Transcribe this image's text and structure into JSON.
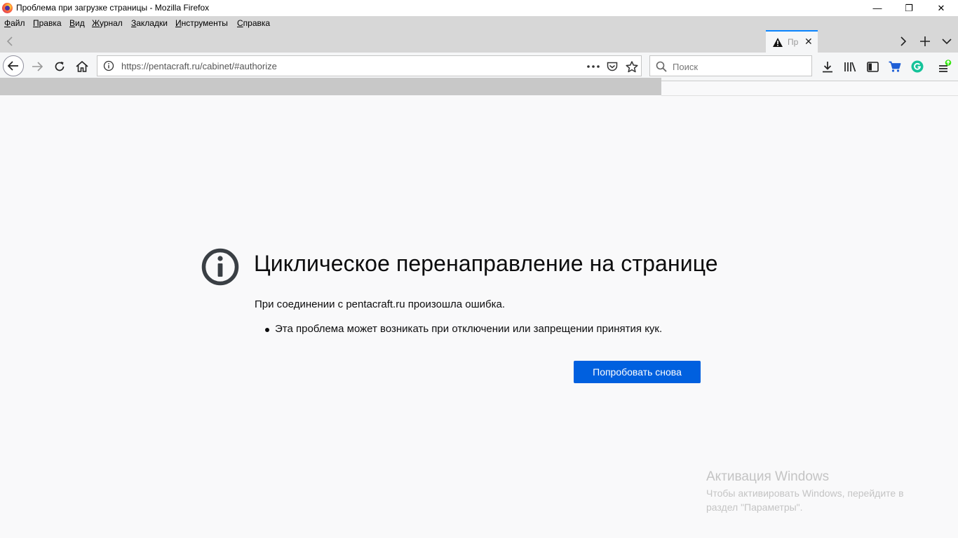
{
  "window": {
    "title": "Проблема при загрузке страницы - Mozilla Firefox",
    "minimize": "—",
    "restore": "❐",
    "close": "✕"
  },
  "menu": [
    "Файл",
    "Правка",
    "Вид",
    "Журнал",
    "Закладки",
    "Инструменты",
    "Справка"
  ],
  "tab": {
    "title": "Пр",
    "close": "✕"
  },
  "urlbar": {
    "url": "https://pentacraft.ru/cabinet/#authorize"
  },
  "search": {
    "placeholder": "Поиск"
  },
  "error": {
    "title": "Циклическое перенаправление на странице",
    "description": "При соединении с pentacraft.ru произошла ошибка.",
    "bullets": [
      "Эта проблема может возникать при отключении или запрещении принятия кук."
    ],
    "retry_label": "Попробовать снова"
  },
  "watermark": {
    "title": "Активация Windows",
    "line1": "Чтобы активировать Windows, перейдите в",
    "line2": "раздел \"Параметры\"."
  },
  "colors": {
    "accent": "#0060df",
    "tab_highlight": "#0a84ff",
    "grammarly": "#15c39a",
    "update_badge": "#30e60b"
  }
}
